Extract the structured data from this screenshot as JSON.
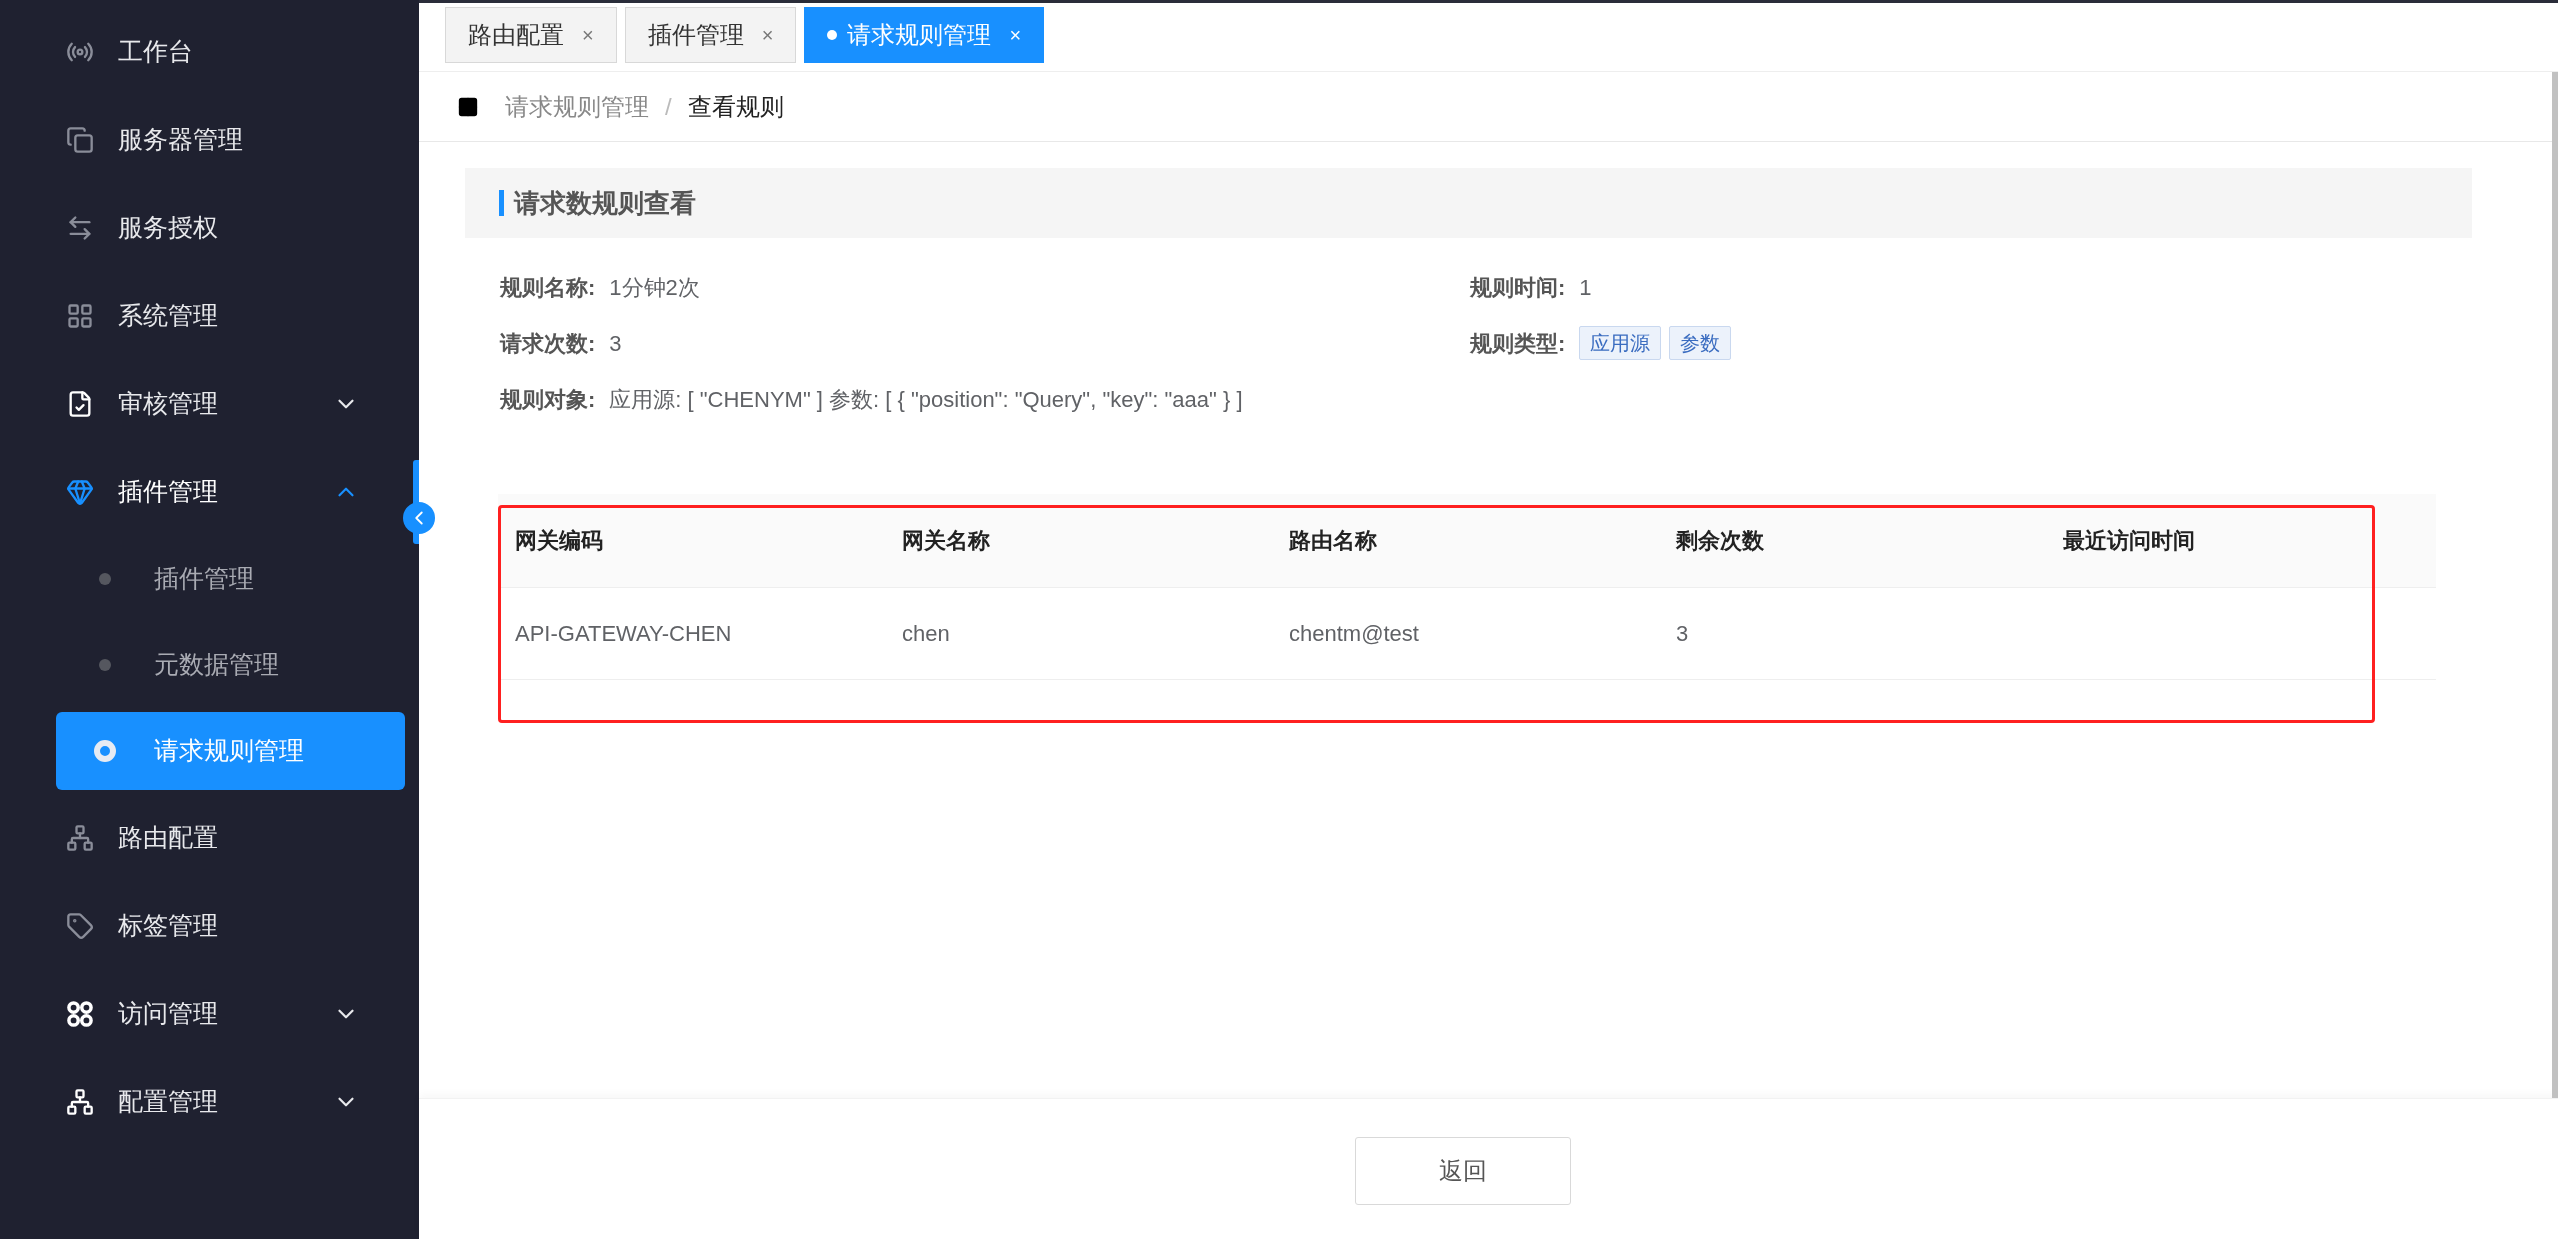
{
  "sidebar": {
    "items": [
      {
        "label": "工作台",
        "selected": false
      },
      {
        "label": "服务器管理",
        "selected": false
      },
      {
        "label": "服务授权",
        "selected": false
      },
      {
        "label": "系统管理",
        "selected": false
      },
      {
        "label": "审核管理",
        "selected": false,
        "expanded": false
      },
      {
        "label": "插件管理",
        "selected": false,
        "expanded": true,
        "children": [
          {
            "label": "插件管理",
            "selected": false
          },
          {
            "label": "元数据管理",
            "selected": false
          },
          {
            "label": "请求规则管理",
            "selected": true
          }
        ]
      },
      {
        "label": "路由配置",
        "selected": false
      },
      {
        "label": "标签管理",
        "selected": false
      },
      {
        "label": "访问管理",
        "selected": false,
        "expanded": false
      },
      {
        "label": "配置管理",
        "selected": false,
        "expanded": false
      }
    ]
  },
  "tabs": [
    {
      "label": "路由配置",
      "close": "×",
      "selected": false
    },
    {
      "label": "插件管理",
      "close": "×",
      "selected": false
    },
    {
      "label": "请求规则管理",
      "close": "×",
      "selected": true
    }
  ],
  "breadcrumb": {
    "items": [
      "请求规则管理",
      "查看规则"
    ],
    "separator": "/"
  },
  "section": {
    "title": "请求数规则查看"
  },
  "details": [
    {
      "label": "规则名称:",
      "kind": "text",
      "value": "1分钟2次"
    },
    {
      "label": "规则时间:",
      "kind": "text",
      "value": "1"
    },
    {
      "label": "请求次数:",
      "kind": "text",
      "value": "3"
    },
    {
      "label": "规则类型:",
      "kind": "tags",
      "tags": [
        "应用源",
        "参数"
      ]
    },
    {
      "label": "规则对象:",
      "kind": "text",
      "value": "应用源: [ \"CHENYM\" ] 参数: [ { \"position\": \"Query\", \"key\": \"aaa\" } ]"
    }
  ],
  "table": {
    "columns": [
      "网关编码",
      "网关名称",
      "路由名称",
      "剩余次数",
      "最近访问时间"
    ],
    "rows": [
      [
        "API-GATEWAY-CHEN",
        "chen",
        "chentm@test",
        "3"
      ]
    ]
  },
  "footer": {
    "back_button": "返回"
  }
}
